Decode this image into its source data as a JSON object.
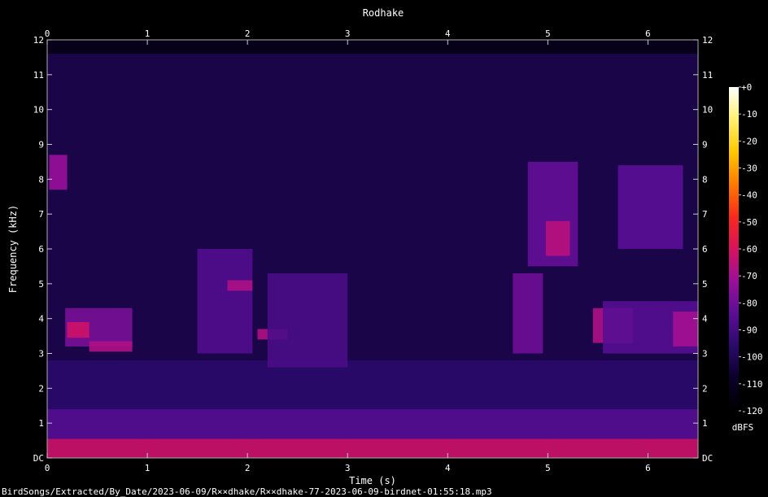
{
  "chart_data": {
    "type": "heatmap",
    "title": "Rodhake",
    "xlabel": "Time (s)",
    "ylabel": "Frequency (kHz)",
    "footer": "BirdSongs/Extracted/By_Date/2023-06-09/R××dhake/R××dhake-77-2023-06-09-birdnet-01:55:18.mp3",
    "xlim": [
      0,
      6.5
    ],
    "ylim": [
      0,
      12
    ],
    "x_ticks": [
      0,
      1,
      2,
      3,
      4,
      5,
      6
    ],
    "x_tick_labels": [
      "0",
      "1",
      "2",
      "3",
      "4",
      "5",
      "6"
    ],
    "y_ticks": [
      0,
      1,
      2,
      3,
      4,
      5,
      6,
      7,
      8,
      9,
      10,
      11,
      12
    ],
    "y_tick_labels": [
      "DC",
      "1",
      "2",
      "3",
      "4",
      "5",
      "6",
      "7",
      "8",
      "9",
      "10",
      "11",
      "12"
    ],
    "noise_ceiling_khz": 11.6,
    "colorbar": {
      "label": "dBFS",
      "range": [
        -120,
        0
      ],
      "ticks": [
        0,
        -10,
        -20,
        -30,
        -40,
        -50,
        -60,
        -70,
        -80,
        -90,
        -100,
        -110,
        -120
      ],
      "tick_labels": [
        "+0",
        "-10",
        "-20",
        "-30",
        "-40",
        "-50",
        "-60",
        "-70",
        "-80",
        "-90",
        "-100",
        "-110",
        "-120"
      ],
      "colors": [
        "#000000",
        "#0a0028",
        "#2a0a6a",
        "#5a0e96",
        "#9a0f9a",
        "#d8125e",
        "#f82a1a",
        "#ff7a00",
        "#ffc800",
        "#fff070",
        "#ffffff"
      ]
    },
    "energy_regions": [
      {
        "t": [
          0.0,
          6.5
        ],
        "f": [
          0.0,
          0.55
        ],
        "db": -62
      },
      {
        "t": [
          0.0,
          6.5
        ],
        "f": [
          0.55,
          1.4
        ],
        "db": -85
      },
      {
        "t": [
          0.0,
          6.5
        ],
        "f": [
          1.4,
          2.8
        ],
        "db": -96
      },
      {
        "t": [
          0.02,
          0.2
        ],
        "f": [
          7.7,
          8.7
        ],
        "db": -72
      },
      {
        "t": [
          0.18,
          0.85
        ],
        "f": [
          3.2,
          4.3
        ],
        "db": -78
      },
      {
        "t": [
          0.2,
          0.42
        ],
        "f": [
          3.45,
          3.9
        ],
        "db": -62
      },
      {
        "t": [
          0.42,
          0.85
        ],
        "f": [
          3.05,
          3.35
        ],
        "db": -68
      },
      {
        "t": [
          1.5,
          2.05
        ],
        "f": [
          3.0,
          6.0
        ],
        "db": -86
      },
      {
        "t": [
          1.8,
          2.05
        ],
        "f": [
          4.8,
          5.1
        ],
        "db": -68
      },
      {
        "t": [
          2.1,
          2.4
        ],
        "f": [
          3.4,
          3.7
        ],
        "db": -68
      },
      {
        "t": [
          2.2,
          3.0
        ],
        "f": [
          2.6,
          5.3
        ],
        "db": -88
      },
      {
        "t": [
          4.65,
          4.95
        ],
        "f": [
          3.0,
          5.3
        ],
        "db": -80
      },
      {
        "t": [
          4.8,
          5.3
        ],
        "f": [
          5.5,
          8.5
        ],
        "db": -82
      },
      {
        "t": [
          4.98,
          5.22
        ],
        "f": [
          5.8,
          6.8
        ],
        "db": -66
      },
      {
        "t": [
          5.45,
          5.85
        ],
        "f": [
          3.3,
          4.3
        ],
        "db": -68
      },
      {
        "t": [
          5.55,
          6.5
        ],
        "f": [
          3.0,
          4.5
        ],
        "db": -85
      },
      {
        "t": [
          5.7,
          6.35
        ],
        "f": [
          6.0,
          8.4
        ],
        "db": -84
      },
      {
        "t": [
          6.25,
          6.5
        ],
        "f": [
          3.2,
          4.2
        ],
        "db": -70
      }
    ]
  }
}
